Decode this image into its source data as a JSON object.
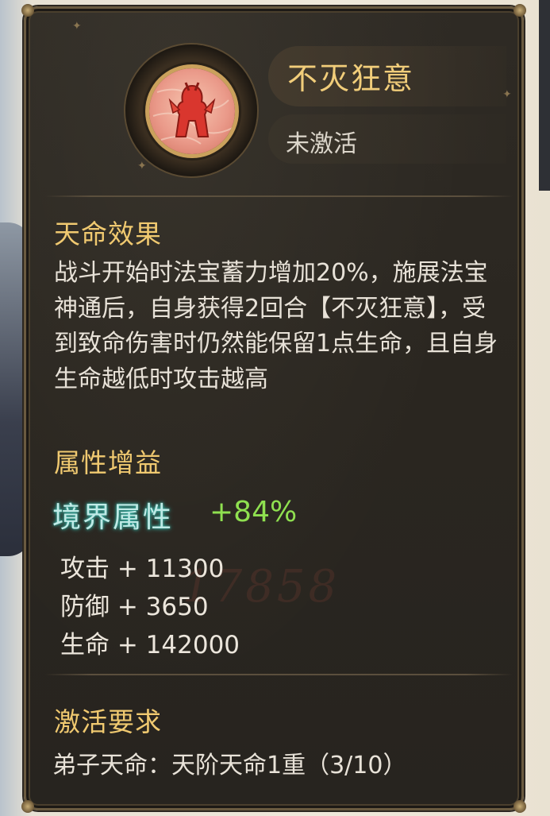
{
  "skill": {
    "name": "不灭狂意",
    "status": "未激活",
    "icon": "flaming-figure-icon"
  },
  "effect": {
    "heading": "天命效果",
    "text": "战斗开始时法宝蓄力增加20%，施展法宝神通后，自身获得2回合【不灭狂意】，受到致命伤害时仍然能保留1点生命，且自身生命越低时攻击越高"
  },
  "attributes": {
    "heading": "属性增益",
    "realm_label": "境界属性",
    "realm_bonus": "+84%",
    "stats": [
      {
        "label": "攻击 + 11300"
      },
      {
        "label": "防御 + 3650"
      },
      {
        "label": "生命 + 142000"
      }
    ]
  },
  "requirement": {
    "heading": "激活要求",
    "text": "弟子天命：天阶天命1重",
    "progress": "（3/10）"
  },
  "colors": {
    "heading_gold": "#f0c970",
    "realm_cyan": "#bfeae6",
    "bonus_green": "#8fe050",
    "panel_bg": "#2a2620"
  }
}
